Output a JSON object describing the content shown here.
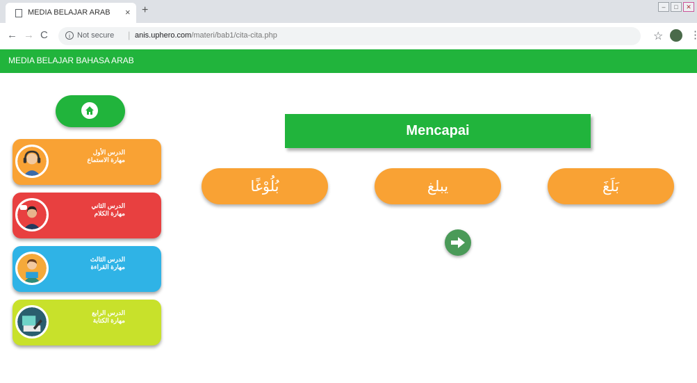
{
  "browser": {
    "tab_title": "MEDIA BELAJAR ARAB",
    "tab_close": "×",
    "new_tab": "+",
    "security_label": "Not secure",
    "url_host": "anis.uphero.com",
    "url_path": "/materi/bab1/cita-cita.php"
  },
  "header": {
    "site_title": "MEDIA BELAJAR BAHASA ARAB",
    "color": "#21b43c"
  },
  "sidebar": {
    "lessons": [
      {
        "line1": "الدرس الأول",
        "line2": "مهارة الاستماع",
        "color": "#f9a234",
        "icon": "headset-person-icon"
      },
      {
        "line1": "الدرس الثاني",
        "line2": "مهارة الكلام",
        "color": "#e84040",
        "icon": "speaking-person-icon"
      },
      {
        "line1": "الدرس الثالث",
        "line2": "مهارة القراءة",
        "color": "#2fb3e6",
        "icon": "reading-person-icon"
      },
      {
        "line1": "الدرس الرابع",
        "line2": "مهارة الكتابة",
        "color": "#c8e12b",
        "icon": "writing-hand-icon"
      }
    ]
  },
  "main": {
    "title": "Mencapai",
    "words": [
      "بُلُوْغًا",
      "يبلغ",
      "بَلَغَ"
    ],
    "word_color": "#f9a234"
  }
}
